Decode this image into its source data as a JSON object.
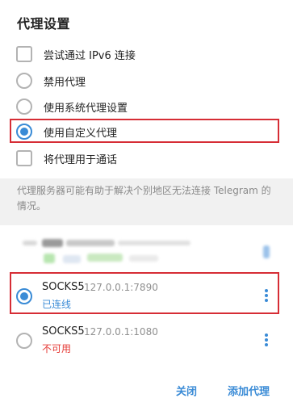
{
  "dialog": {
    "title": "代理设置",
    "options": {
      "ipv6": "尝试通过 IPv6 连接",
      "disable": "禁用代理",
      "system": "使用系统代理设置",
      "custom": "使用自定义代理",
      "calls": "将代理用于通话"
    },
    "info": "代理服务器可能有助于解决个别地区无法连接 Telegram 的情况。",
    "proxies": [
      {
        "type": "SOCKS5",
        "address": "127.0.0.1:7890",
        "status": "已连线",
        "status_color": "#3a8bd6",
        "selected": true
      },
      {
        "type": "SOCKS5",
        "address": "127.0.0.1:1080",
        "status": "不可用",
        "status_color": "#e53935",
        "selected": false
      }
    ],
    "buttons": {
      "close": "关闭",
      "add": "添加代理"
    }
  },
  "colors": {
    "accent": "#3a8bd6",
    "highlight": "#d62d35",
    "error": "#e53935"
  }
}
